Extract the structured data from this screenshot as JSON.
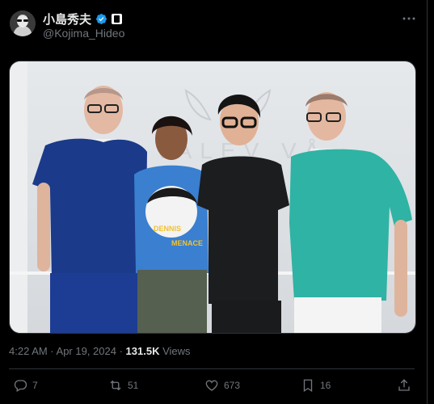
{
  "author": {
    "display_name": "小島秀夫",
    "handle": "@Kojima_Hideo",
    "avatar_icon": "avatar-portrait",
    "verified_color": "#1d9bf0"
  },
  "post": {
    "timestamp": "4:22 AM · Apr 19, 2024",
    "separator": " · ",
    "views_count": "131.5K",
    "views_label": " Views",
    "image": {
      "description_icon": "photo-group-of-four",
      "sweater_text_top": "DENNIS",
      "sweater_text_bottom": "MENACE",
      "wall_logo_text": "VALEV VÅ"
    }
  },
  "actions": {
    "replies": "7",
    "reposts": "51",
    "likes": "673",
    "bookmarks": "16"
  },
  "theme": {
    "background": "#000000",
    "text_primary": "#e7e9ea",
    "text_secondary": "#71767b",
    "border": "#2f3336"
  }
}
